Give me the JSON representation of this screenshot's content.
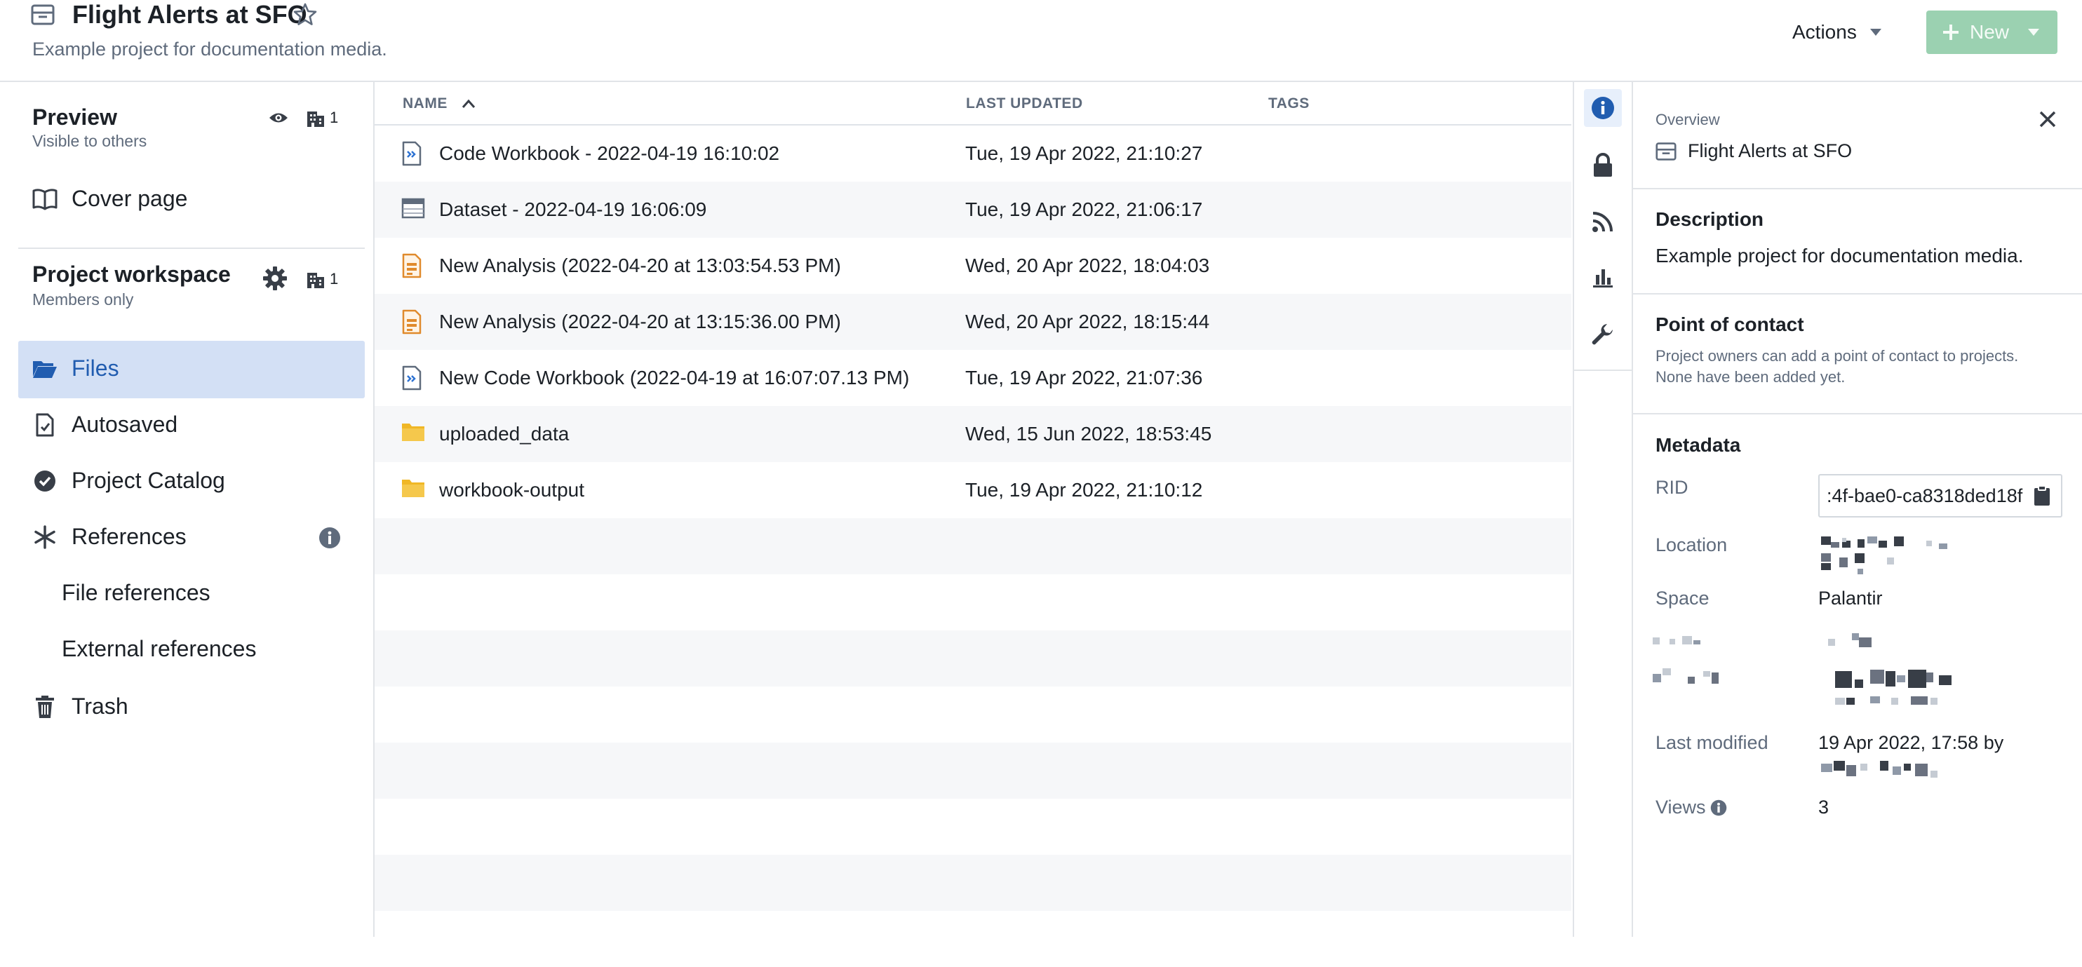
{
  "header": {
    "title": "Flight Alerts at SFO",
    "subtitle": "Example project for documentation media.",
    "actions_label": "Actions",
    "new_label": "New"
  },
  "sidebar": {
    "preview": {
      "title": "Preview",
      "subtitle": "Visible to others",
      "count": "1"
    },
    "cover_page": "Cover page",
    "workspace": {
      "title": "Project workspace",
      "subtitle": "Members only",
      "count": "1"
    },
    "items": [
      {
        "label": "Files",
        "icon": "folder-open-icon",
        "selected": true
      },
      {
        "label": "Autosaved",
        "icon": "document-icon"
      },
      {
        "label": "Project Catalog",
        "icon": "badge-check-icon"
      },
      {
        "label": "References",
        "icon": "asterisk-icon"
      },
      {
        "label": "File references",
        "icon": null
      },
      {
        "label": "External references",
        "icon": null
      },
      {
        "label": "Trash",
        "icon": "trash-icon"
      }
    ]
  },
  "files": {
    "columns": [
      "NAME",
      "LAST UPDATED",
      "TAGS"
    ],
    "rows": [
      {
        "name": "Code Workbook - 2022-04-19 16:10:02",
        "updated": "Tue, 19 Apr 2022, 21:10:27",
        "icon": "code-workbook-icon"
      },
      {
        "name": "Dataset - 2022-04-19 16:06:09",
        "updated": "Tue, 19 Apr 2022, 21:06:17",
        "icon": "dataset-icon"
      },
      {
        "name": "New Analysis (2022-04-20 at 13:03:54.53 PM)",
        "updated": "Wed, 20 Apr 2022, 18:04:03",
        "icon": "analysis-icon"
      },
      {
        "name": "New Analysis (2022-04-20 at 13:15:36.00 PM)",
        "updated": "Wed, 20 Apr 2022, 18:15:44",
        "icon": "analysis-icon"
      },
      {
        "name": "New Code Workbook (2022-04-19 at 16:07:07.13 PM)",
        "updated": "Tue, 19 Apr 2022, 21:07:36",
        "icon": "code-workbook-icon"
      },
      {
        "name": "uploaded_data",
        "updated": "Wed, 15 Jun 2022, 18:53:45",
        "icon": "folder-icon"
      },
      {
        "name": "workbook-output",
        "updated": "Tue, 19 Apr 2022, 21:10:12",
        "icon": "folder-icon"
      }
    ]
  },
  "rail": [
    "info-icon",
    "lock-icon",
    "rss-icon",
    "bar-chart-icon",
    "wrench-icon"
  ],
  "details": {
    "overview_label": "Overview",
    "overview_title": "Flight Alerts at SFO",
    "description_heading": "Description",
    "description_text": "Example project for documentation media.",
    "contact_heading": "Point of contact",
    "contact_text_1": "Project owners can add a point of contact to projects.",
    "contact_text_2": "None have been added yet.",
    "metadata_heading": "Metadata",
    "rid_label": "RID",
    "rid_value": ":4f-bae0-ca8318ded18f",
    "location_label": "Location",
    "space_label": "Space",
    "space_value": "Palantir",
    "last_modified_label": "Last modified",
    "last_modified_value": "19 Apr 2022, 17:58 by",
    "views_label": "Views",
    "views_value": "3"
  },
  "colors": {
    "accent": "#2d72d2",
    "selected_bg": "#d3e0f5",
    "new_button_bg": "#9bd1b1",
    "folder": "#f0b726",
    "analysis": "#e08a2c"
  }
}
